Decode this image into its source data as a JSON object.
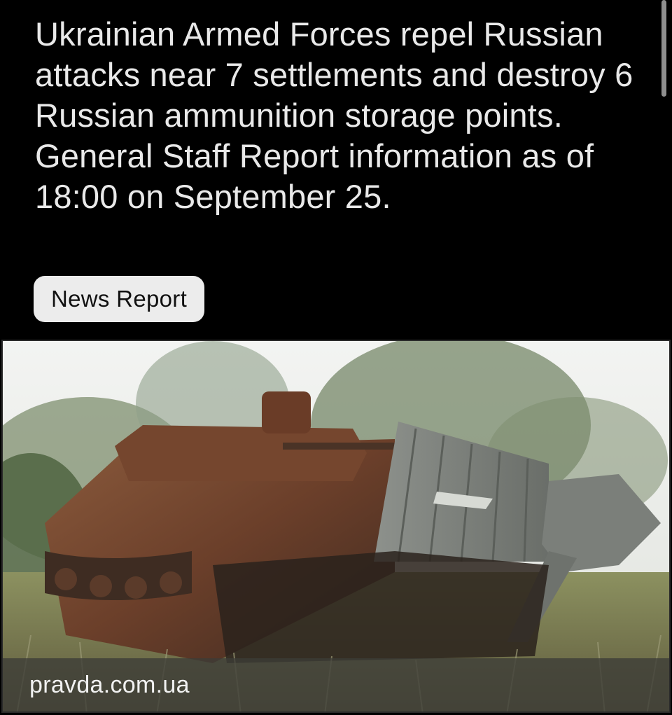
{
  "article": {
    "headline": "Ukrainian Armed Forces repel Russian attacks near 7 settlements and destroy 6 Russian ammunition storage points. General Staff Report information as of 18:00 on September 25.",
    "category_chip": "News Report",
    "source": "pravda.com.ua"
  },
  "colors": {
    "background": "#000000",
    "headline_text": "#e9e9e9",
    "chip_background": "#ececec"
  }
}
